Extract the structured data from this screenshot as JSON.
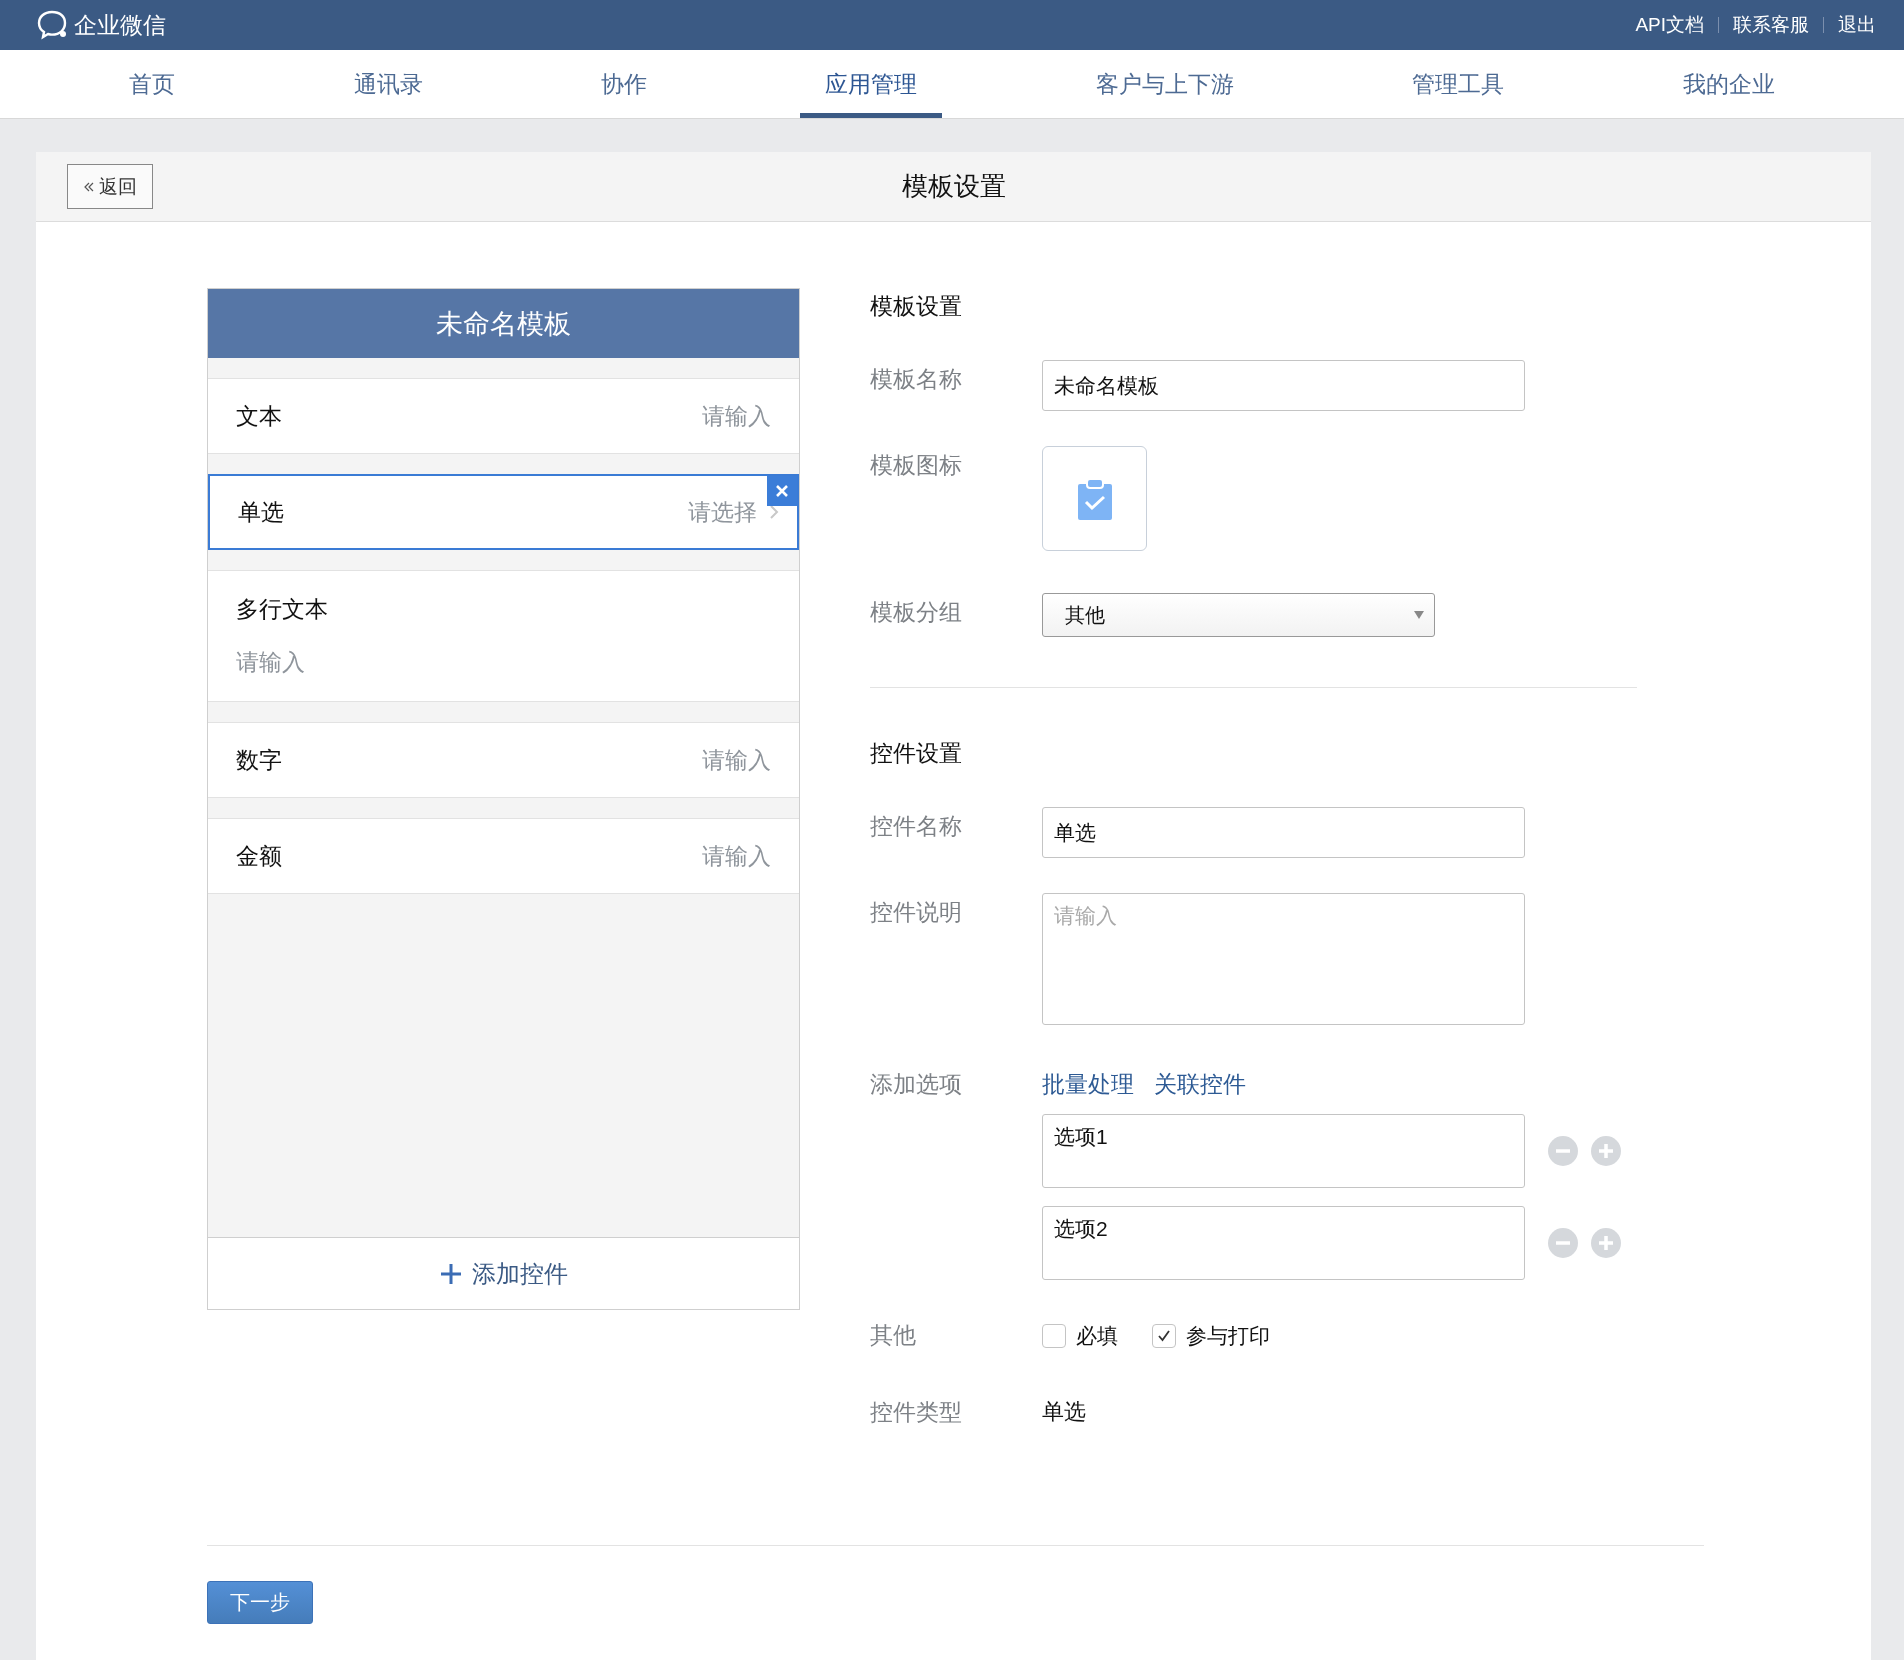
{
  "topbar": {
    "logo": "企业微信",
    "links": [
      "API文档",
      "联系客服",
      "退出"
    ]
  },
  "nav": [
    {
      "label": "首页",
      "selected": false
    },
    {
      "label": "通讯录",
      "selected": false
    },
    {
      "label": "协作",
      "selected": false
    },
    {
      "label": "应用管理",
      "selected": true
    },
    {
      "label": "客户与上下游",
      "selected": false
    },
    {
      "label": "管理工具",
      "selected": false
    },
    {
      "label": "我的企业",
      "selected": false
    }
  ],
  "page": {
    "back": "返回",
    "title": "模板设置"
  },
  "preview": {
    "title": "未命名模板",
    "fields": [
      {
        "kind": "input",
        "label": "文本",
        "hint": "请输入",
        "selected": false
      },
      {
        "kind": "select",
        "label": "单选",
        "hint": "请选择",
        "selected": true
      },
      {
        "kind": "textarea",
        "label": "多行文本",
        "hint": "请输入",
        "selected": false
      },
      {
        "kind": "input",
        "label": "数字",
        "hint": "请输入",
        "selected": false
      },
      {
        "kind": "input",
        "label": "金额",
        "hint": "请输入",
        "selected": false
      }
    ],
    "add": "添加控件"
  },
  "template": {
    "heading": "模板设置",
    "name_label": "模板名称",
    "name_value": "未命名模板",
    "icon_label": "模板图标",
    "group_label": "模板分组",
    "group_value": "其他"
  },
  "control": {
    "heading": "控件设置",
    "name_label": "控件名称",
    "name_value": "单选",
    "desc_label": "控件说明",
    "desc_placeholder": "请输入",
    "options_label": "添加选项",
    "option_links": [
      "批量处理",
      "关联控件"
    ],
    "options": [
      "选项1",
      "选项2"
    ],
    "other_label": "其他",
    "checks": [
      {
        "label": "必填",
        "checked": false
      },
      {
        "label": "参与打印",
        "checked": true
      }
    ],
    "type_label": "控件类型",
    "type_value": "单选"
  },
  "next_button": "下一步"
}
